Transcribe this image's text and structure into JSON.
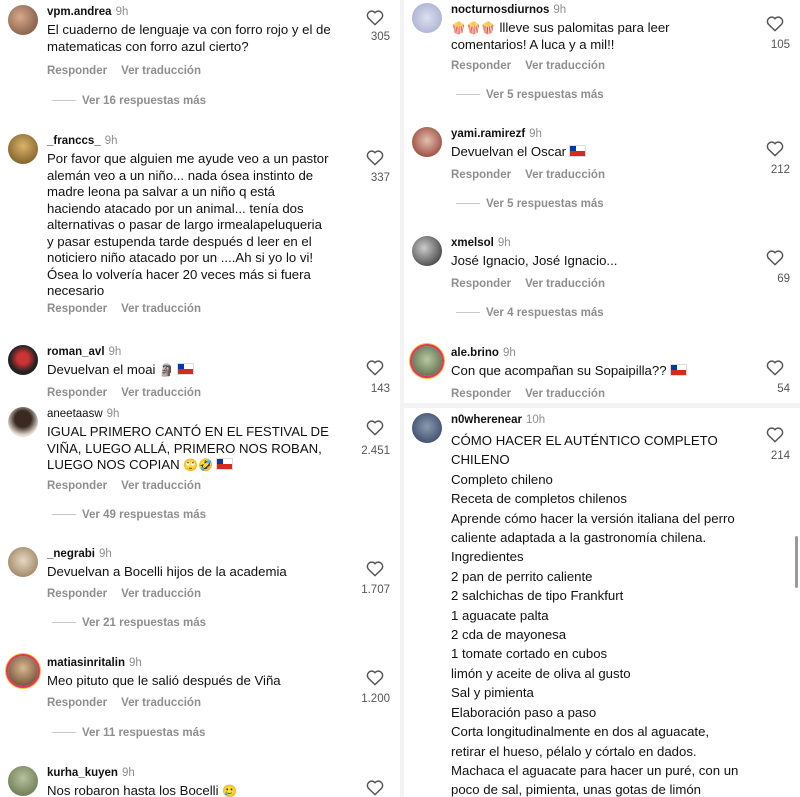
{
  "labels": {
    "reply": "Responder",
    "translate": "Ver traducción"
  },
  "left": [
    {
      "user": "vpm.andrea",
      "time": "9h",
      "text": "El cuaderno de lenguaje va con forro rojo y el de matematicas con forro azul cierto?",
      "likes": "305",
      "replies": "Ver 16 respuestas más"
    },
    {
      "user": "_franccs_",
      "time": "9h",
      "text": "Por favor que alguien me ayude veo a un pastor alemán veo a un niño... nada ósea instinto de madre leona pa salvar a un niño q está haciendo atacado por un animal... tenía dos alternativas o pasar de largo irmealapeluqueria y pasar estupenda tarde después d leer en el noticiero niño atacado por un ....Ah si yo lo vi! Ósea lo volvería hacer 20 veces más si fuera necesario",
      "likes": "337",
      "replies": ""
    },
    {
      "user": "roman_avl",
      "time": "9h",
      "text": "Devuelvan el moai",
      "emoji": "🗿",
      "flag": true,
      "likes": "143",
      "replies": ""
    },
    {
      "user": "aneetaasw",
      "time": "9h",
      "text": "IGUAL PRIMERO CANTÓ EN EL FESTIVAL DE VIÑA, LUEGO ALLÁ, PRIMERO NOS ROBAN, LUEGO NOS COPIAN",
      "emoji": "🙄🤣",
      "flag": true,
      "likes": "2.451",
      "replies": "Ver 49 respuestas más"
    },
    {
      "user": "_negrabi",
      "time": "9h",
      "text": "Devuelvan a Bocelli hijos de la academia",
      "likes": "1.707",
      "replies": "Ver 21 respuestas más"
    },
    {
      "user": "matiasinritalin",
      "time": "9h",
      "text": "Meo pituto que le salió después de Viña",
      "likes": "1.200",
      "replies": "Ver 11 respuestas más"
    },
    {
      "user": "kurha_kuyen",
      "time": "9h",
      "text": "Nos robaron hasta los Bocelli",
      "emoji": "🥲",
      "likes": "",
      "replies": ""
    }
  ],
  "right": [
    {
      "user": "nocturnosdiurnos",
      "time": "9h",
      "text": "llleve sus palomitas para leer comentarios! A luca y a mil!!",
      "emoji_pre": "🍿🍿🍿",
      "likes": "105",
      "replies": "Ver 5 respuestas más"
    },
    {
      "user": "yami.ramirezf",
      "time": "9h",
      "text": "Devuelvan el Oscar",
      "flag": true,
      "likes": "212",
      "replies": "Ver 5 respuestas más"
    },
    {
      "user": "xmelsol",
      "time": "9h",
      "text": "José Ignacio, José Ignacio...",
      "likes": "69",
      "replies": "Ver 4 respuestas más"
    },
    {
      "user": "ale.brino",
      "time": "9h",
      "text": "Con que acompañan su Sopaipilla??",
      "flag": true,
      "likes": "54",
      "replies": ""
    },
    {
      "user": "n0wherenear",
      "time": "10h",
      "text": "CÓMO HACER EL AUTÉNTICO COMPLETO CHILENO",
      "likes": "214",
      "replies": "",
      "lines": [
        "Completo chileno",
        "Receta de completos chilenos",
        "Aprende cómo hacer la versión italiana del perro caliente adaptada a la gastronomía chilena.",
        "Ingredientes",
        "2 pan de perrito caliente",
        "2 salchichas de tipo Frankfurt",
        "1 aguacate palta",
        "2 cda de mayonesa",
        "1 tomate cortado en cubos",
        "limón y aceite de oliva al gusto",
        "Sal y pimienta",
        "Elaboración paso a paso",
        "Corta longitudinalmente en dos al aguacate, retirar el hueso, pélalo y córtalo en dados.",
        "Machaca el aguacate para hacer un puré, con un poco de sal, pimienta, unas gotas de limón"
      ]
    }
  ],
  "avatars": [
    "#8a6b5a",
    "#a67c3a",
    "#444",
    "#6b5a4d",
    "#b59a7a",
    "#7a5a3a",
    "#c0a080",
    "#aab0cc",
    "#9b3b30",
    "#555",
    "#4f6b4a",
    "#3a4a6a"
  ]
}
